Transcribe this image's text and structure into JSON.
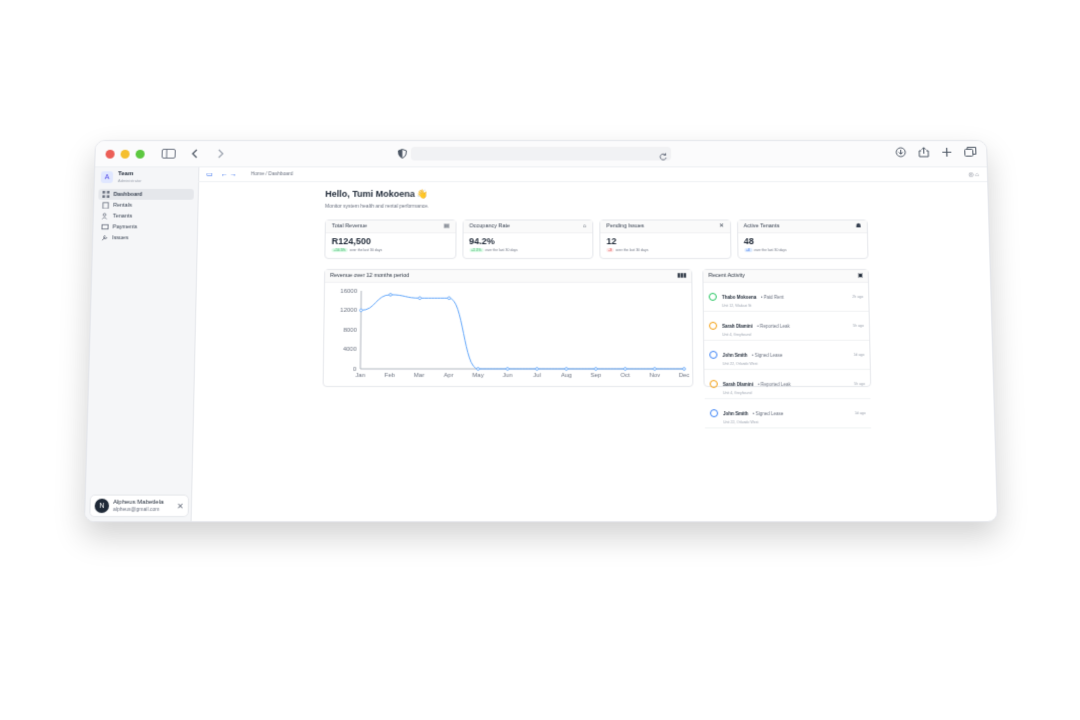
{
  "window": {
    "dots": [
      "#ec5f57",
      "#f5bf2e",
      "#5dc840"
    ]
  },
  "sidebar": {
    "team_logo": "A",
    "team_name": "Team",
    "team_sub": "Administrator",
    "items": [
      {
        "label": "Dashboard",
        "icon": "grid-icon",
        "active": true
      },
      {
        "label": "Rentals",
        "icon": "building-icon"
      },
      {
        "label": "Tenants",
        "icon": "users-icon"
      },
      {
        "label": "Payments",
        "icon": "card-icon"
      },
      {
        "label": "Issues",
        "icon": "wrench-icon"
      }
    ]
  },
  "user": {
    "initial": "N",
    "name": "Alpheus Mabetlela",
    "email": "alpheus@gmail.com"
  },
  "topbar": {
    "breadcrumb": "Home / Dashboard"
  },
  "header": {
    "greeting": "Hello, Tumi Mokoena 👋",
    "subtitle": "Monitor system health and rental performance."
  },
  "stats": [
    {
      "title": "Total Revenue",
      "value": "R124,500",
      "delta": "+10.5%",
      "delta_color": "green",
      "note": "over the last 30 days"
    },
    {
      "title": "Occupancy Rate",
      "value": "94.2%",
      "delta": "+2.1%",
      "delta_color": "green",
      "note": "over the last 30 days"
    },
    {
      "title": "Pending Issues",
      "value": "12",
      "delta": "-3",
      "delta_color": "red",
      "note": "over the last 30 days"
    },
    {
      "title": "Active Tenants",
      "value": "48",
      "delta": "+4",
      "delta_color": "blue",
      "note": "over the last 30 days"
    }
  ],
  "chart_title": "Revenue over 12 months period",
  "chart_data": {
    "type": "line",
    "categories": [
      "Jan",
      "Feb",
      "Mar",
      "Apr",
      "May",
      "Jun",
      "Jul",
      "Aug",
      "Sep",
      "Oct",
      "Nov",
      "Dec"
    ],
    "values": [
      12000,
      15200,
      14500,
      14500,
      0,
      0,
      0,
      0,
      0,
      0,
      0,
      0
    ],
    "ylim": [
      0,
      16000
    ],
    "yticks": [
      0,
      4000,
      8000,
      12000,
      16000
    ],
    "line_color": "#60a5fa"
  },
  "activity": {
    "title": "Recent Activity",
    "items": [
      {
        "name": "Thabo Mokoena",
        "action": "• Paid Rent",
        "unit": "Unit 12, Vilakazi St",
        "time": "2h ago",
        "color": "#22c55e"
      },
      {
        "name": "Sarah Dlamini",
        "action": "• Reported Leak",
        "unit": "Unit 4, Greyhound",
        "time": "5h ago",
        "color": "#f59e0b"
      },
      {
        "name": "John Smith",
        "action": "• Signed Lease",
        "unit": "Unit 22, Orlando West",
        "time": "1d ago",
        "color": "#3b82f6"
      },
      {
        "name": "Sarah Dlamini",
        "action": "• Reported Leak",
        "unit": "Unit 4, Greyhound",
        "time": "5h ago",
        "color": "#f59e0b"
      },
      {
        "name": "John Smith",
        "action": "• Signed Lease",
        "unit": "Unit 22, Orlando West",
        "time": "1d ago",
        "color": "#3b82f6"
      }
    ]
  }
}
